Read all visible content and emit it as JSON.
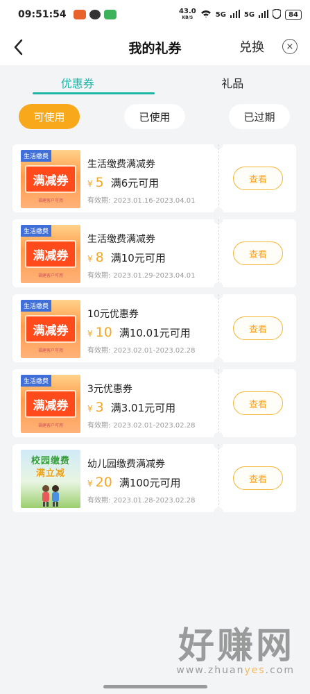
{
  "status_bar": {
    "time": "09:51:54",
    "net_speed": "43.0",
    "net_unit": "KB/S",
    "signal1": "5G",
    "signal2": "5G",
    "battery": "84"
  },
  "header": {
    "title": "我的礼券",
    "redeem_label": "兑换",
    "close_icon": "×"
  },
  "tabs": [
    {
      "label": "优惠券",
      "active": true
    },
    {
      "label": "礼品",
      "active": false
    }
  ],
  "filters": [
    {
      "label": "可使用",
      "active": true
    },
    {
      "label": "已使用",
      "active": false
    },
    {
      "label": "已过期",
      "active": false
    }
  ],
  "coupons": [
    {
      "name": "生活缴费满减券",
      "currency": "¥",
      "amount": "5",
      "condition": "满6元可用",
      "valid_label": "有效期:",
      "valid_range": "2023.01.16-2023.04.01",
      "button": "查看",
      "thumb_tag": "生活缴费",
      "thumb_text": "满减券",
      "thumb_foot": "福建客户可用"
    },
    {
      "name": "生活缴费满减券",
      "currency": "¥",
      "amount": "8",
      "condition": "满10元可用",
      "valid_label": "有效期:",
      "valid_range": "2023.01.29-2023.04.01",
      "button": "查看",
      "thumb_tag": "生活缴费",
      "thumb_text": "满减券",
      "thumb_foot": "福建客户可用"
    },
    {
      "name": "10元优惠券",
      "currency": "¥",
      "amount": "10",
      "condition": "满10.01元可用",
      "valid_label": "有效期:",
      "valid_range": "2023.02.01-2023.02.28",
      "button": "查看",
      "thumb_tag": "生活缴费",
      "thumb_text": "满减券",
      "thumb_foot": "福建客户可用"
    },
    {
      "name": "3元优惠券",
      "currency": "¥",
      "amount": "3",
      "condition": "满3.01元可用",
      "valid_label": "有效期:",
      "valid_range": "2023.02.01-2023.02.28",
      "button": "查看",
      "thumb_tag": "生活缴费",
      "thumb_text": "满减券",
      "thumb_foot": "福建客户可用"
    },
    {
      "name": "幼儿园缴费满减券",
      "currency": "¥",
      "amount": "20",
      "condition": "满100元可用",
      "valid_label": "有效期:",
      "valid_range": "2023.01.28-2023.02.28",
      "button": "查看",
      "thumb_school_line1": "校园缴费",
      "thumb_school_line2": "满立减"
    }
  ],
  "watermark": {
    "big": "好赚网",
    "url_pre": "www.zhuan",
    "url_hl": "yes",
    "url_post": ".com"
  },
  "colors": {
    "accent_teal": "#1fb5a6",
    "accent_orange": "#f5a623",
    "chip_active": "#f7a81b"
  }
}
